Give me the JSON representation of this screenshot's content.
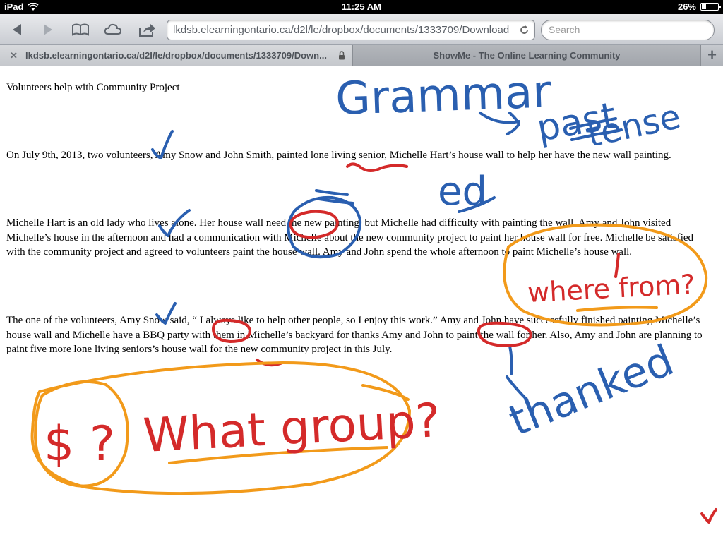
{
  "status_bar": {
    "device": "iPad",
    "time": "11:25 AM",
    "battery": "26%",
    "battery_level": 0.26
  },
  "toolbar": {
    "url": "lkdsb.elearningontario.ca/d2l/le/dropbox/documents/1333709/Download",
    "search_placeholder": "Search"
  },
  "tabs": [
    {
      "label": "lkdsb.elearningontario.ca/d2l/le/dropbox/documents/1333709/Down..."
    },
    {
      "label": "ShowMe - The Online Learning Community"
    }
  ],
  "document": {
    "title": "Volunteers help with Community Project",
    "paragraphs": [
      " On July 9th, 2013, two volunteers, Amy Snow and John Smith, painted lone living senior, Michelle Hart’s house wall to help her have the new wall painting.",
      " Michelle Hart is an old lady who lives alone. Her house wall need the new painting, but Michelle had difficulty with painting the wall.  Amy and John visited Michelle’s house in the afternoon and had a communication with Michelle about the new community project to paint her house wall for free. Michelle be satisfied with the community project and agreed to volunteers paint the house wall. Amy and John spend the whole afternoon to paint Michelle’s house wall.",
      "   The one of the volunteers, Amy Snow said, “ I always like to help other people, so I enjoy this work.” Amy and John have successfully finished painting Michelle’s house wall and Michelle have a BBQ party with them in Michelle’s backyard for thanks Amy and John to paint the wall for her. Also, Amy and John are planning to paint five more lone living seniors’s house wall for the new community project in this July."
    ]
  },
  "annotations": {
    "grammar": "Grammar",
    "past": "past",
    "tense": "tense",
    "ed": "ed",
    "where_from": "where from?",
    "thanked": "thanked",
    "dollar_question": "$ ?",
    "what_group": "What group?"
  },
  "colors": {
    "blue_ink": "#2a5fb0",
    "red_ink": "#d42a2a",
    "orange_ink": "#f29a1a"
  }
}
